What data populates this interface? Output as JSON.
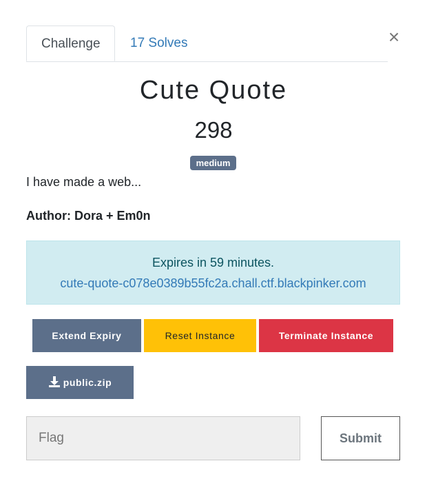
{
  "tabs": {
    "challenge": "Challenge",
    "solves": "17 Solves"
  },
  "close_glyph": "×",
  "challenge": {
    "name": "Cute Quote",
    "points": "298",
    "difficulty": "medium",
    "description": "I have made a web...",
    "author": "Author: Dora + Em0n"
  },
  "instance": {
    "expires": "Expires in 59 minutes.",
    "link": "cute-quote-c078e0389b55fc2a.chall.ctf.blackpinker.com"
  },
  "buttons": {
    "extend": "Extend Expiry",
    "reset": "Reset Instance",
    "terminate": "Terminate Instance",
    "download": "public.zip"
  },
  "flag_form": {
    "placeholder": "Flag",
    "submit": "Submit"
  },
  "colors": {
    "primary": "#5c6f8a",
    "warning": "#ffc107",
    "danger": "#dc3545",
    "info_bg": "#d1ecf1",
    "link": "#337ab7"
  },
  "icons": {
    "close": "close-icon",
    "download": "download-icon"
  }
}
